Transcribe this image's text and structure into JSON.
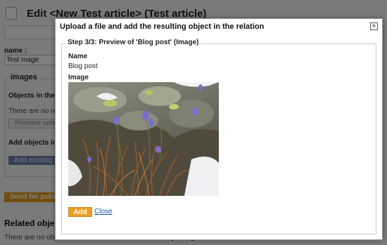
{
  "background": {
    "page_title": "Edit <New Test article> (Test article)",
    "name_label": "name :",
    "name_value": "Test mage",
    "images_legend": "images",
    "objects_in_relation": "Objects in the re",
    "no_related": "There are no rela",
    "remove_selected": "Remove selec",
    "add_objects": "Add objects in",
    "add_existing": "Add existing o",
    "send_for_publication": "Send for publi",
    "related_objects": "Related object",
    "related_none": "There are no objects related to the one that is currently being edited."
  },
  "dialog": {
    "title": "Upload a file and add the resulting object in the relation",
    "close_glyph": "×",
    "step_legend": "Step 3/3: Preview of 'Blog post' (Image)",
    "name_label": "Name",
    "name_value": "Blog post",
    "image_label": "Image",
    "image_icon": "photo-flowers-icon",
    "add_button": "Add",
    "close_link": "Close"
  },
  "colors": {
    "accent_orange": "#e8a024",
    "link_blue": "#1a57a6",
    "overlay": "rgba(0,0,0,0.5)"
  }
}
